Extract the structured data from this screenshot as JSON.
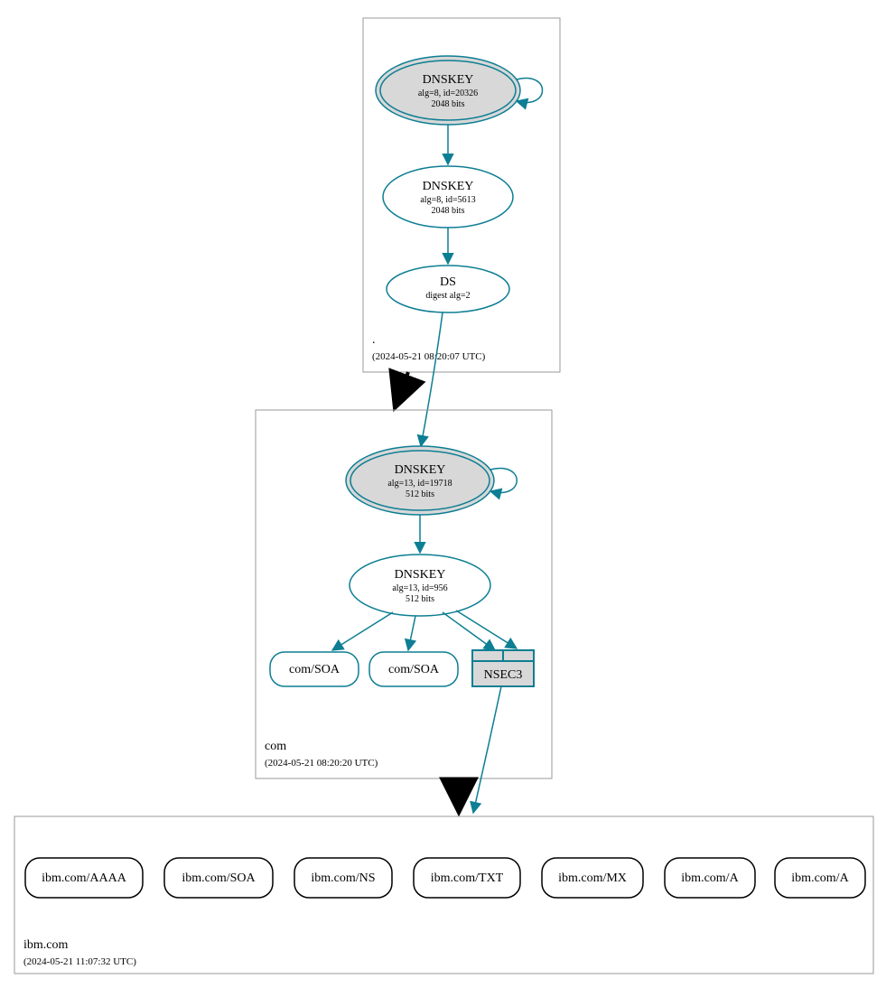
{
  "colors": {
    "teal": "#0d7e93",
    "grayFill": "#d8d8d8",
    "black": "#000000",
    "zoneBorder": "#9a9a9a"
  },
  "zones": {
    "root": {
      "label": ".",
      "timestamp": "(2024-05-21 08:20:07 UTC)",
      "ksk": {
        "title": "DNSKEY",
        "line2": "alg=8, id=20326",
        "line3": "2048 bits"
      },
      "zsk": {
        "title": "DNSKEY",
        "line2": "alg=8, id=5613",
        "line3": "2048 bits"
      },
      "ds": {
        "title": "DS",
        "line2": "digest alg=2"
      }
    },
    "com": {
      "label": "com",
      "timestamp": "(2024-05-21 08:20:20 UTC)",
      "ksk": {
        "title": "DNSKEY",
        "line2": "alg=13, id=19718",
        "line3": "512 bits"
      },
      "zsk": {
        "title": "DNSKEY",
        "line2": "alg=13, id=956",
        "line3": "512 bits"
      },
      "soa1": "com/SOA",
      "soa2": "com/SOA",
      "nsec3": "NSEC3"
    },
    "ibm": {
      "label": "ibm.com",
      "timestamp": "(2024-05-21 11:07:32 UTC)",
      "records": [
        "ibm.com/AAAA",
        "ibm.com/SOA",
        "ibm.com/NS",
        "ibm.com/TXT",
        "ibm.com/MX",
        "ibm.com/A",
        "ibm.com/A"
      ]
    }
  }
}
